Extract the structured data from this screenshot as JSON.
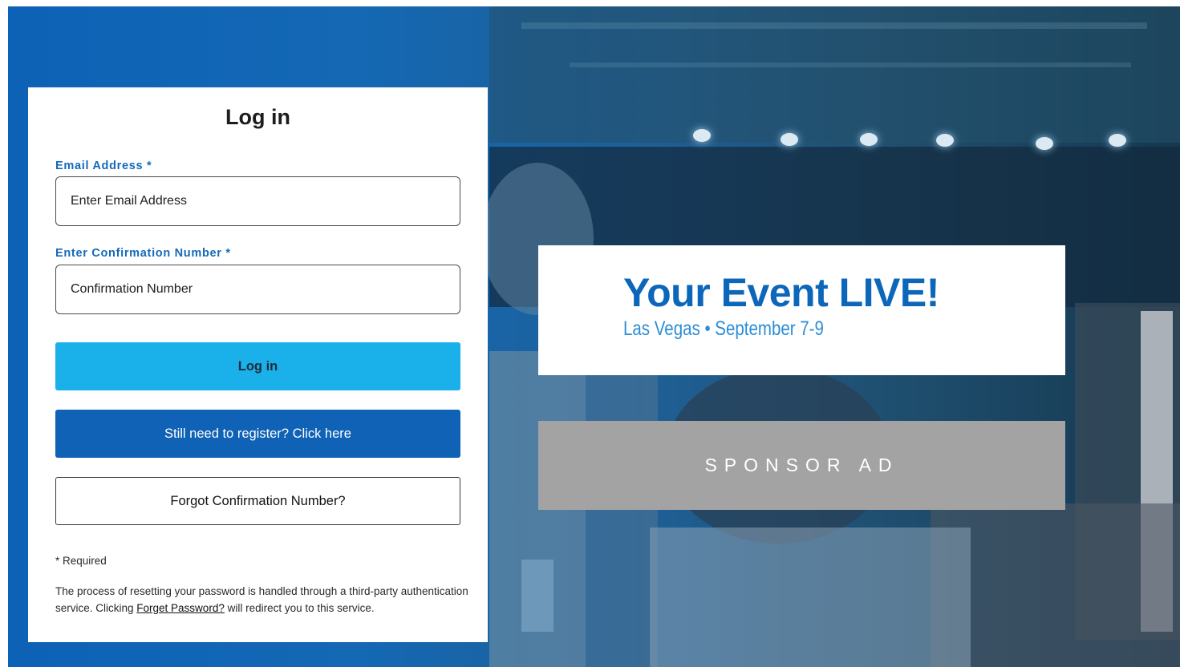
{
  "login": {
    "title": "Log in",
    "email_label": "Email Address *",
    "email_placeholder": "Enter Email Address",
    "confirmation_label": "Enter Confirmation Number *",
    "confirmation_placeholder": "Confirmation Number",
    "login_button": "Log in",
    "register_button": "Still need to register? Click here",
    "forgot_button": "Forgot Confirmation Number?",
    "required_note": "* Required",
    "info_before": "The process of resetting your password is handled through a third-party authentication service. Clicking ",
    "info_link": "Forget Password?",
    "info_after": " will redirect you to this service."
  },
  "event": {
    "title": "Your Event LIVE!",
    "subtitle": "Las Vegas • September 7-9"
  },
  "sponsor": {
    "label": "SPONSOR AD"
  },
  "colors": {
    "accent_blue": "#0f62b5",
    "login_button": "#1ab0ea",
    "label_blue": "#1469b8",
    "sponsor_gray": "#a3a3a3"
  }
}
